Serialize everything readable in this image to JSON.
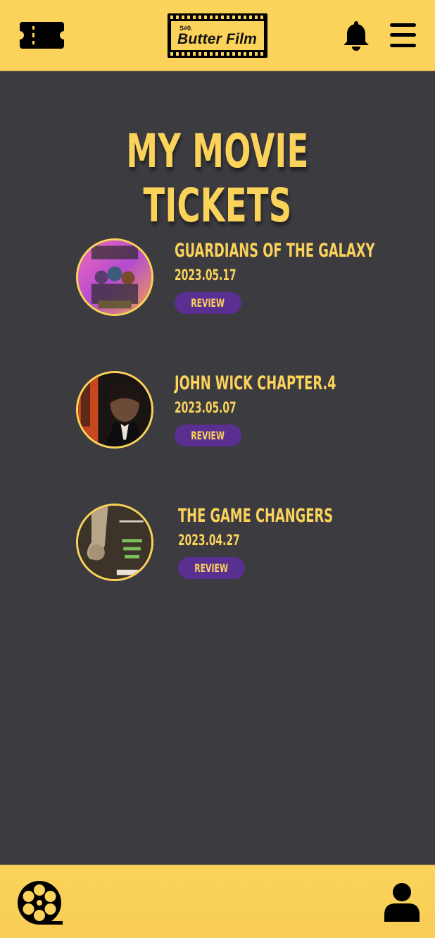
{
  "header": {
    "logo_small": "S#0.",
    "logo_text": "Butter Film",
    "icons": [
      "ticket-icon",
      "bell-icon",
      "menu-icon"
    ]
  },
  "main": {
    "title": "MY MOVIE TICKETS",
    "tickets": [
      {
        "title": "GUARDIANS OF THE GALAXY",
        "date": "2023.05.17",
        "action": "REVIEW"
      },
      {
        "title": "JOHN WICK CHAPTER.4",
        "date": "2023.05.07",
        "action": "REVIEW"
      },
      {
        "title": "THE GAME CHANGERS",
        "date": "2023.04.27",
        "action": "REVIEW"
      }
    ]
  },
  "bottom_nav": {
    "icons": [
      "film-reel-icon",
      "user-icon"
    ]
  },
  "colors": {
    "accent": "#fbd35a",
    "background": "#3c3b40",
    "button": "#5a2f92"
  }
}
